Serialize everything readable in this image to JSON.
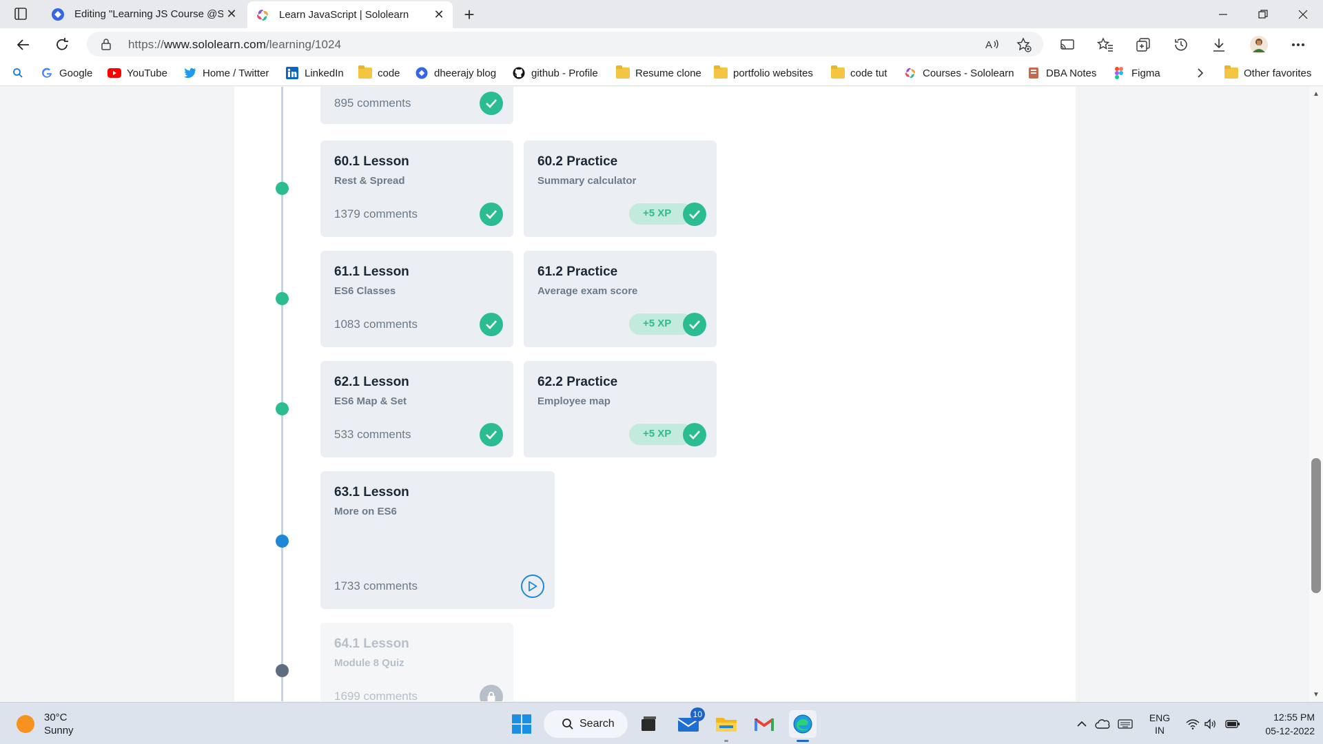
{
  "browser": {
    "tabs": [
      {
        "title": "Editing \"Learning JS Course @So",
        "icon": "blue-diamond-icon",
        "active": false
      },
      {
        "title": "Learn JavaScript | Sololearn",
        "icon": "sololearn-icon",
        "active": true
      }
    ],
    "address": {
      "prefix": "https://",
      "host": "www.sololearn.com",
      "path": "/learning/1024"
    },
    "bookmarks": [
      {
        "label": "Google",
        "icon": "google-icon"
      },
      {
        "label": "YouTube",
        "icon": "youtube-icon"
      },
      {
        "label": "Home / Twitter",
        "icon": "twitter-icon"
      },
      {
        "label": "LinkedIn",
        "icon": "linkedin-icon"
      },
      {
        "label": "code",
        "icon": "folder-icon"
      },
      {
        "label": "dheerajy blog",
        "icon": "blog-icon"
      },
      {
        "label": "github - Profile",
        "icon": "github-icon"
      },
      {
        "label": "Resume clone",
        "icon": "folder-icon"
      },
      {
        "label": "portfolio websites",
        "icon": "folder-icon"
      },
      {
        "label": "code tut",
        "icon": "folder-icon"
      },
      {
        "label": "Courses - Sololearn",
        "icon": "sololearn-icon"
      },
      {
        "label": "DBA Notes",
        "icon": "notes-icon"
      },
      {
        "label": "Figma",
        "icon": "figma-icon"
      },
      {
        "label": "Other favorites",
        "icon": "folder-icon"
      }
    ]
  },
  "course": {
    "top_card": {
      "comments": "895 comments"
    },
    "rows": [
      {
        "lesson": {
          "title": "60.1 Lesson",
          "subtitle": "Rest & Spread",
          "comments": "1379 comments"
        },
        "practice": {
          "title": "60.2 Practice",
          "subtitle": "Summary calculator",
          "xp": "+5 XP"
        }
      },
      {
        "lesson": {
          "title": "61.1 Lesson",
          "subtitle": "ES6 Classes",
          "comments": "1083 comments"
        },
        "practice": {
          "title": "61.2 Practice",
          "subtitle": "Average exam score",
          "xp": "+5 XP"
        }
      },
      {
        "lesson": {
          "title": "62.1 Lesson",
          "subtitle": "ES6 Map & Set",
          "comments": "533 comments"
        },
        "practice": {
          "title": "62.2 Practice",
          "subtitle": "Employee map",
          "xp": "+5 XP"
        }
      }
    ],
    "current": {
      "title": "63.1 Lesson",
      "subtitle": "More on ES6",
      "comments": "1733 comments"
    },
    "locked": {
      "title": "64.1 Lesson",
      "subtitle": "Module 8 Quiz",
      "comments": "1699 comments"
    }
  },
  "taskbar": {
    "weather": {
      "temp": "30°C",
      "condition": "Sunny"
    },
    "search_label": "Search",
    "mail_badge": "10",
    "lang": {
      "line1": "ENG",
      "line2": "IN"
    },
    "clock": {
      "time": "12:55 PM",
      "date": "05-12-2022"
    }
  },
  "colors": {
    "done": "#2bbc8f",
    "current": "#1e88d7",
    "locked": "#5e6d7e"
  }
}
